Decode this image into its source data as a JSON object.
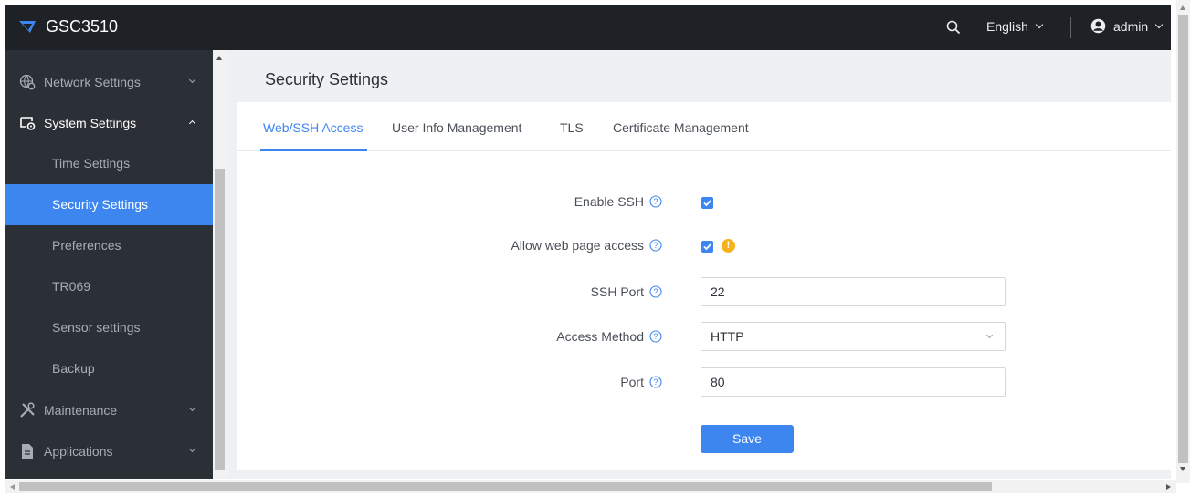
{
  "header": {
    "app_name": "GSC3510",
    "language": "English",
    "user": "admin",
    "logo_icon": "grandstream-logo-icon",
    "search_icon": "search-icon",
    "user_icon": "user-avatar-icon",
    "bg_color": "#1e2126"
  },
  "sidebar": {
    "bg_color": "#2b2f36",
    "active_color": "#3d86ef",
    "groups": [
      {
        "label": "Network Settings",
        "icon": "network-globe-icon",
        "expanded": false
      },
      {
        "label": "System Settings",
        "icon": "system-settings-icon",
        "expanded": true
      },
      {
        "label": "Maintenance",
        "icon": "tools-icon",
        "expanded": false
      },
      {
        "label": "Applications",
        "icon": "document-icon",
        "expanded": false
      }
    ],
    "items": [
      {
        "label": "Time Settings",
        "active": false
      },
      {
        "label": "Security Settings",
        "active": true
      },
      {
        "label": "Preferences",
        "active": false
      },
      {
        "label": "TR069",
        "active": false
      },
      {
        "label": "Sensor settings",
        "active": false
      },
      {
        "label": "Backup",
        "active": false
      }
    ]
  },
  "page": {
    "title": "Security Settings",
    "tabs": [
      {
        "label": "Web/SSH Access",
        "active": true
      },
      {
        "label": "User Info Management",
        "active": false
      },
      {
        "label": "TLS",
        "active": false
      },
      {
        "label": "Certificate Management",
        "active": false
      }
    ]
  },
  "form": {
    "enable_ssh": {
      "label": "Enable SSH",
      "checked": true
    },
    "allow_web": {
      "label": "Allow web page access",
      "checked": true,
      "warning_icon": "warning-icon"
    },
    "ssh_port": {
      "label": "SSH Port",
      "value": "22"
    },
    "access_method": {
      "label": "Access Method",
      "value": "HTTP"
    },
    "port": {
      "label": "Port",
      "value": "80"
    },
    "help_icon": "question-circle-icon",
    "save_label": "Save"
  }
}
